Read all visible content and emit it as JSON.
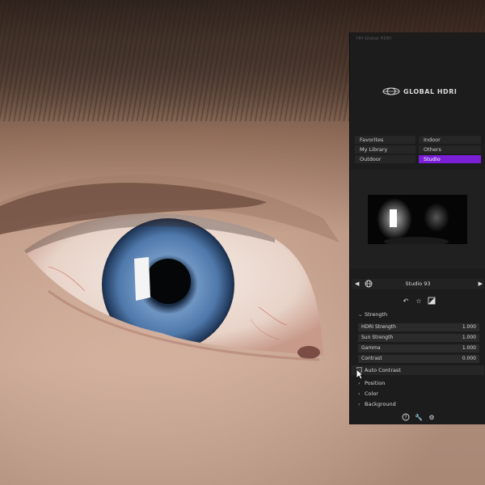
{
  "panel": {
    "title": "HH Global HDRI",
    "logo_text": "GLOBAL HDRI",
    "categories_left": [
      "Favorites",
      "My Library",
      "Outdoor"
    ],
    "categories_right": [
      "Indoor",
      "Others",
      "Studio"
    ],
    "active_category": "Studio",
    "hdri_name": "Studio 93",
    "nav_prev_icon": "triangle-left-icon",
    "nav_next_icon": "triangle-right-icon",
    "strength": {
      "label": "Strength",
      "properties": [
        {
          "label": "HDRI Strength",
          "value": "1.000"
        },
        {
          "label": "Sun Strength",
          "value": "1.000"
        },
        {
          "label": "Gamma",
          "value": "1.000"
        },
        {
          "label": "Contrast",
          "value": "0.000"
        }
      ]
    },
    "auto_contrast": {
      "label": "Auto Contrast",
      "checked": false
    },
    "sections": [
      "Position",
      "Color",
      "Background"
    ],
    "icons": {
      "actions": [
        "undo-icon",
        "star-icon",
        "image-icon"
      ],
      "footer": [
        "help-icon",
        "wrench-icon",
        "gear-icon"
      ]
    },
    "accent_color": "#7a1fd6"
  }
}
